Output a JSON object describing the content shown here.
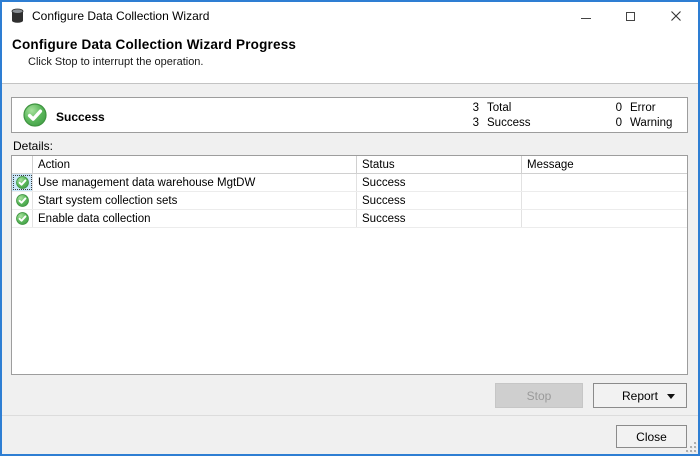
{
  "window": {
    "title": "Configure Data Collection Wizard"
  },
  "icons": {
    "window_icon": "database-icon",
    "titlebar": [
      "minimize-icon",
      "maximize-icon",
      "close-icon"
    ],
    "status_icon": "success-check-icon",
    "report_button_icon": "dropdown-arrow-icon",
    "corner": "resize-grip"
  },
  "header": {
    "title": "Configure Data Collection Wizard Progress",
    "subtitle": "Click Stop to interrupt the operation."
  },
  "summary": {
    "status_label": "Success",
    "stats": [
      {
        "value": "3",
        "label": "Total"
      },
      {
        "value": "3",
        "label": "Success"
      },
      {
        "value": "0",
        "label": "Error"
      },
      {
        "value": "0",
        "label": "Warning"
      }
    ]
  },
  "details": {
    "label": "Details:",
    "columns": [
      "Action",
      "Status",
      "Message"
    ],
    "rows": [
      {
        "action": "Use management data warehouse MgtDW",
        "status": "Success",
        "message": ""
      },
      {
        "action": "Start system collection sets",
        "status": "Success",
        "message": ""
      },
      {
        "action": "Enable data collection",
        "status": "Success",
        "message": ""
      }
    ]
  },
  "buttons": {
    "stop": "Stop",
    "report": "Report",
    "close": "Close"
  },
  "colors": {
    "accent_border": "#2e7ed3",
    "success_green": "#4caf50",
    "dialog_bg": "#f0f0f0"
  }
}
